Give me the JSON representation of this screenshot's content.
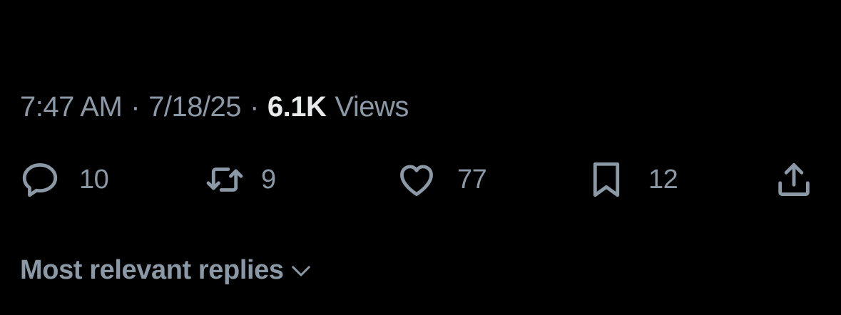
{
  "post_meta": {
    "time": "7:47 AM",
    "separator": "·",
    "date": "7/18/25",
    "views_count": "6.1K",
    "views_label": "Views"
  },
  "actions": {
    "reply": {
      "icon": "reply-bubble-icon",
      "count": "10"
    },
    "repost": {
      "icon": "repost-arrows-icon",
      "count": "9"
    },
    "like": {
      "icon": "heart-icon",
      "count": "77"
    },
    "bookmark": {
      "icon": "bookmark-icon",
      "count": "12"
    },
    "share": {
      "icon": "share-upload-icon"
    }
  },
  "replies_sort": {
    "label": "Most relevant replies",
    "icon": "chevron-down-icon"
  },
  "colors": {
    "background": "#000000",
    "muted_text": "#8b98a5",
    "primary_text": "#e7e9ea"
  }
}
